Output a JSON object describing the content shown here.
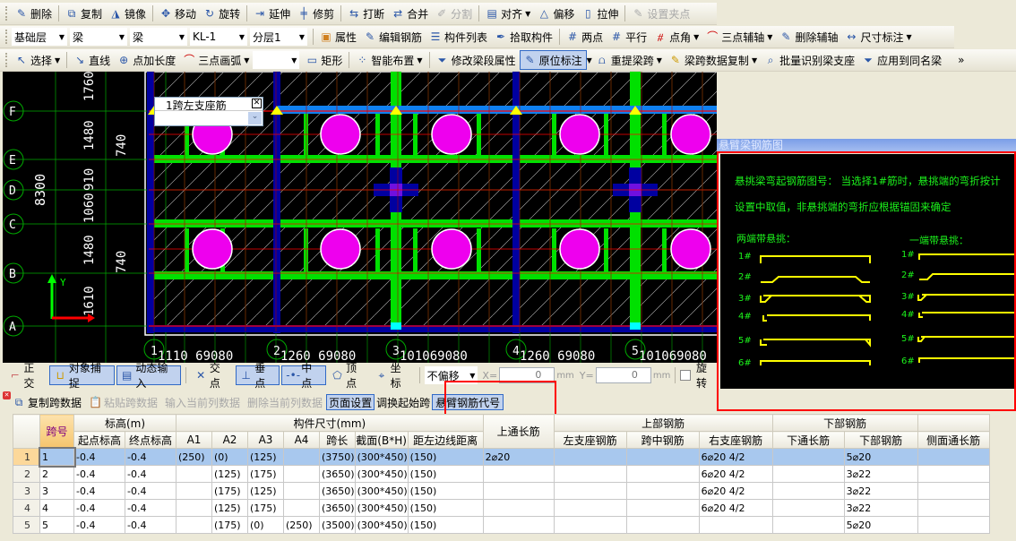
{
  "toolbar1": [
    "删除",
    "复制",
    "镜像",
    "移动",
    "旋转",
    "延伸",
    "修剪",
    "打断",
    "合并",
    "分割",
    "对齐",
    "偏移",
    "拉伸",
    "设置夹点"
  ],
  "toolbar2": {
    "floor": "基础层",
    "type1": "梁",
    "type2": "梁",
    "component": "KL-1",
    "layer": "分层1",
    "buttons": [
      "属性",
      "编辑钢筋",
      "构件列表",
      "拾取构件",
      "两点",
      "平行",
      "点角",
      "三点辅轴",
      "删除辅轴",
      "尺寸标注"
    ]
  },
  "toolbar3": [
    "选择",
    "直线",
    "点加长度",
    "三点画弧",
    "矩形",
    "智能布置",
    "修改梁段属性",
    "原位标注",
    "重提梁跨",
    "梁跨数据复制",
    "批量识别梁支座",
    "应用到同名梁"
  ],
  "cad": {
    "row_axes": [
      "F",
      "E",
      "D",
      "C",
      "B",
      "A"
    ],
    "col_axes": [
      "1",
      "2",
      "3",
      "4",
      "5"
    ],
    "dims_left": [
      "1760",
      "1480",
      "910",
      "1060",
      "1480",
      "1610"
    ],
    "dims_left2": [
      "740",
      "740"
    ],
    "total": "8300",
    "dims_bottom": [
      "1110 69080",
      "1260 69080",
      "101069080",
      "1260 69080",
      "101069080"
    ],
    "y_label": "Y",
    "popup": {
      "title": "1跨左支座筋",
      "value": ""
    }
  },
  "dialog": {
    "title": "悬臂梁钢筋图",
    "line1": "悬挑梁弯起钢筋图号：   当选择1#筋时，悬挑端的弯折按计",
    "line2": "设置中取值，非悬挑端的弯折应根据锚固来确定",
    "both_ends": "两端带悬挑：",
    "one_end": "一端带悬挑：",
    "numbers": [
      "1#",
      "2#",
      "3#",
      "4#",
      "5#",
      "6#"
    ],
    "rebar_color": "#ffff00"
  },
  "status": {
    "ortho": "正交",
    "snap": "对象捕捉",
    "dyn": "动态输入",
    "intersect": "交点",
    "perp": "垂点",
    "mid": "中点",
    "vertex": "顶点",
    "coord": "坐标",
    "offset": "不偏移",
    "x_label": "X=",
    "x": "0",
    "y_label": "Y=",
    "y": "0",
    "unit": "mm",
    "rotate": "旋转"
  },
  "panel": {
    "buttons": [
      "复制跨数据",
      "粘贴跨数据",
      "输入当前列数据",
      "删除当前列数据",
      "页面设置",
      "调换起始跨",
      "悬臂钢筋代号"
    ]
  },
  "table": {
    "groups": [
      "跨号",
      "标高(m)",
      "构件尺寸(mm)",
      "上通长筋",
      "上部钢筋",
      "下部钢筋",
      ""
    ],
    "cols": [
      "起点标高",
      "终点标高",
      "A1",
      "A2",
      "A3",
      "A4",
      "跨长",
      "截面(B*H)",
      "距左边线距离",
      "左支座钢筋",
      "跨中钢筋",
      "右支座钢筋",
      "下通长筋",
      "下部钢筋",
      "侧面通长筋"
    ],
    "rows": [
      [
        "1",
        "1",
        "-0.4",
        "-0.4",
        "(250)",
        "(0)",
        "(125)",
        "",
        "(3750)",
        "(300*450)",
        "(150)",
        "2⌀20",
        "",
        "",
        "6⌀20 4/2",
        "",
        "5⌀20",
        ""
      ],
      [
        "2",
        "2",
        "-0.4",
        "-0.4",
        "",
        "(125)",
        "(175)",
        "",
        "(3650)",
        "(300*450)",
        "(150)",
        "",
        "",
        "",
        "6⌀20 4/2",
        "",
        "3⌀22",
        ""
      ],
      [
        "3",
        "3",
        "-0.4",
        "-0.4",
        "",
        "(175)",
        "(125)",
        "",
        "(3650)",
        "(300*450)",
        "(150)",
        "",
        "",
        "",
        "6⌀20 4/2",
        "",
        "3⌀22",
        ""
      ],
      [
        "4",
        "4",
        "-0.4",
        "-0.4",
        "",
        "(125)",
        "(175)",
        "",
        "(3650)",
        "(300*450)",
        "(150)",
        "",
        "",
        "",
        "6⌀20 4/2",
        "",
        "3⌀22",
        ""
      ],
      [
        "5",
        "5",
        "-0.4",
        "-0.4",
        "",
        "(175)",
        "(0)",
        "(250)",
        "(3500)",
        "(300*450)",
        "(150)",
        "",
        "",
        "",
        "",
        "",
        "5⌀20",
        ""
      ]
    ]
  },
  "colors": {
    "highlight": "#ff0000",
    "beam_green": "#00e000",
    "beam_blue": "#0000a0",
    "column": "#ee00ee"
  }
}
